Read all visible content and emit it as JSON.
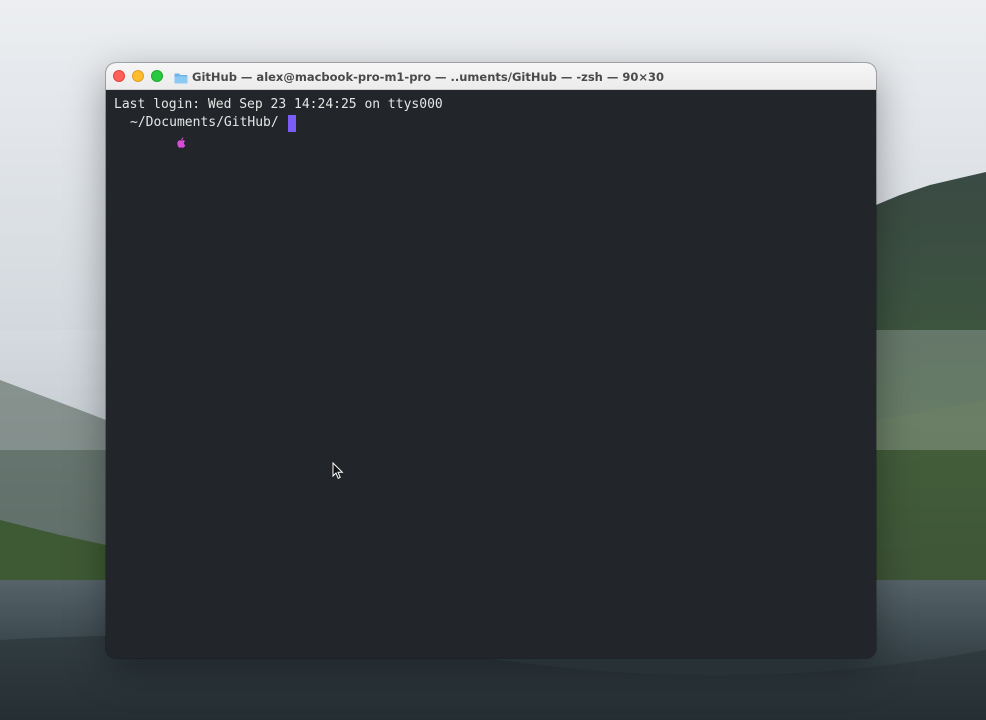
{
  "window": {
    "title": "GitHub — alex@macbook-pro-m1-pro — ..uments/GitHub — -zsh — 90×30",
    "folder_icon": "folder-icon",
    "controls": {
      "close": "close-button",
      "minimize": "minimize-button",
      "zoom": "zoom-button"
    }
  },
  "terminal": {
    "last_login": "Last login: Wed Sep 23 14:24:25 on ttys000",
    "prompt_icon": "apple-icon",
    "prompt_path": "~/Documents/GitHub/",
    "cursor_color": "#7b5cf6",
    "background_color": "#22252a"
  },
  "desktop": {
    "wallpaper": "misty-mountain-lake"
  }
}
